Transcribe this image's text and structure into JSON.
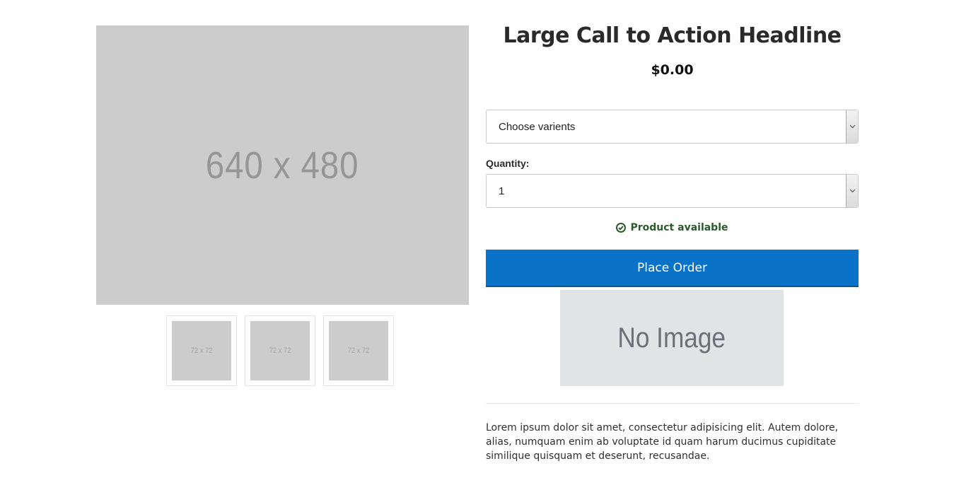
{
  "product": {
    "main_image": {
      "label": "640 x 480"
    },
    "thumbnails": [
      {
        "label": "72 x 72"
      },
      {
        "label": "72 x 72"
      },
      {
        "label": "72 x 72"
      }
    ],
    "headline": "Large Call to Action Headline",
    "price": "$0.00",
    "variant_select": {
      "value": "Choose varients"
    },
    "quantity": {
      "label": "Quantity:",
      "value": "1"
    },
    "availability": {
      "text": "Product available",
      "icon": "check-circle-icon",
      "color": "#2a5a2a"
    },
    "order_button": {
      "label": "Place Order",
      "color": "#0a73c8"
    },
    "secondary_image": {
      "label": "No Image"
    },
    "description": "Lorem ipsum dolor sit amet, consectetur adipisicing elit. Autem dolore, alias, numquam enim ab voluptate id quam harum ducimus cupiditate similique quisquam et deserunt, recusandae."
  }
}
